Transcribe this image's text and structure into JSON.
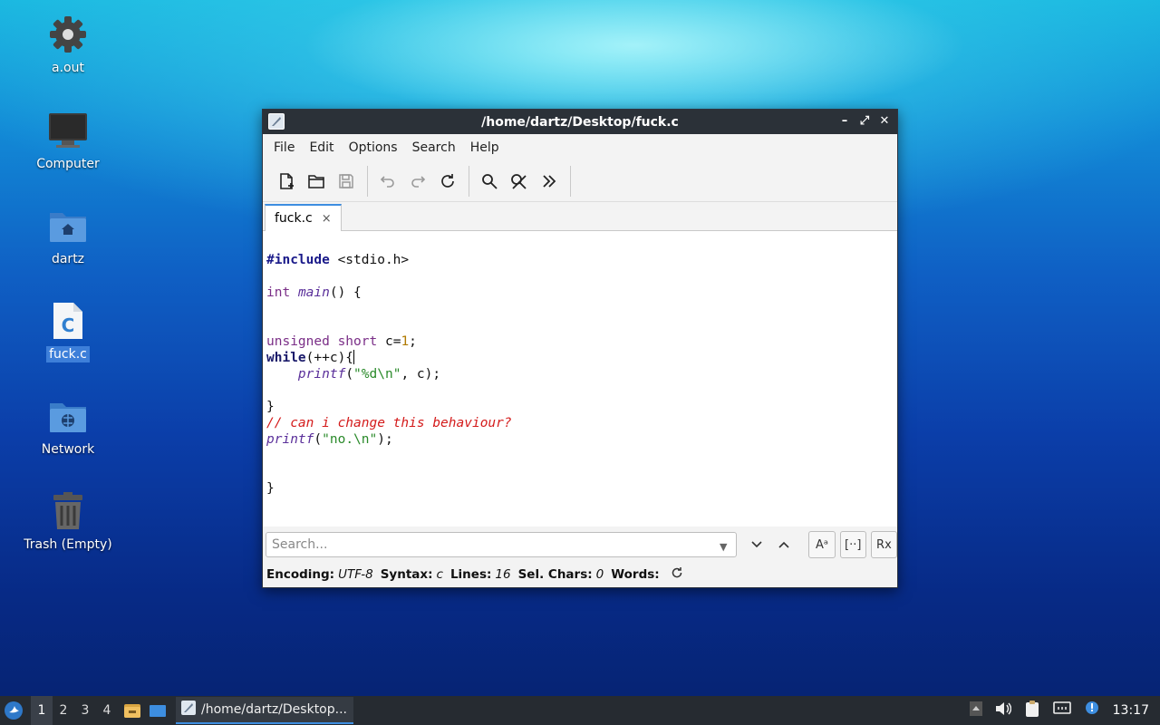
{
  "desktop": {
    "icons": [
      {
        "label": "a.out"
      },
      {
        "label": "Computer"
      },
      {
        "label": "dartz"
      },
      {
        "label": "fuck.c"
      },
      {
        "label": "Network"
      },
      {
        "label": "Trash (Empty)"
      }
    ]
  },
  "window": {
    "title": "/home/dartz/Desktop/fuck.c",
    "menu": [
      "File",
      "Edit",
      "Options",
      "Search",
      "Help"
    ],
    "tab": {
      "label": "fuck.c",
      "close": "×"
    }
  },
  "editor": {
    "lines": [
      "#include <stdio.h>",
      "",
      "int main() {",
      "",
      "",
      "unsigned short c=1;",
      "while(++c){",
      "    printf(\"%d\\n\", c);",
      "",
      "}",
      "// can i change this behaviour?",
      "printf(\"no.\\n\");",
      "",
      "",
      "}"
    ]
  },
  "search": {
    "placeholder": "Search...",
    "match_case_label": "Aᵃ",
    "whole_word_label": "[··]",
    "regex_label": "Rx"
  },
  "status": {
    "encoding_label": "Encoding:",
    "encoding": "UTF-8",
    "syntax_label": "Syntax:",
    "syntax": "c",
    "lines_label": "Lines:",
    "lines": "16",
    "selchars_label": "Sel. Chars:",
    "selchars": "0",
    "words_label": "Words:"
  },
  "taskbar": {
    "workspaces": [
      "1",
      "2",
      "3",
      "4"
    ],
    "task_label": "/home/dartz/Desktop...",
    "clock": "13:17"
  },
  "colors": {
    "accent": "#3d8ee0",
    "titlebar": "#2b3138",
    "taskbar": "#262b31"
  }
}
